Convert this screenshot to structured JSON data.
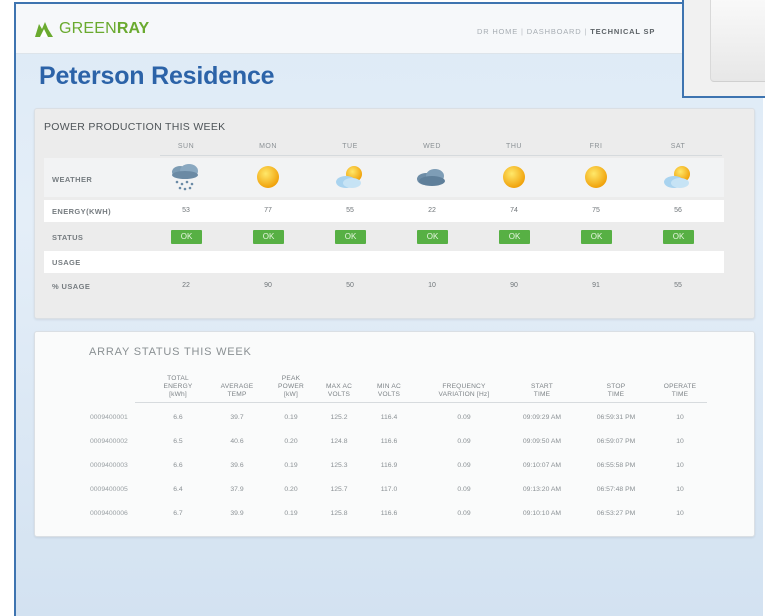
{
  "header": {
    "logo": {
      "part1": "GREEN",
      "part2": "RAY"
    },
    "nav": [
      "DR HOME",
      "DASHBOARD",
      "TECHNICAL SP"
    ],
    "nav_active_index": 2
  },
  "page_title": "Peterson Residence",
  "power": {
    "title": "POWER PRODUCTION THIS WEEK",
    "days": [
      "SUN",
      "MON",
      "TUE",
      "WED",
      "THU",
      "FRI",
      "SAT"
    ],
    "row_labels": {
      "weather": "WEATHER",
      "energy": "ENERGY(KWH)",
      "status": "STATUS",
      "usage": "USAGE",
      "pct_usage": "% USAGE"
    },
    "weather": [
      "rain-cloud-icon",
      "sun-icon",
      "partly-cloudy-icon",
      "cloud-icon",
      "sun-icon",
      "sun-icon",
      "partly-cloudy-icon"
    ],
    "energy": [
      "53",
      "77",
      "55",
      "22",
      "74",
      "75",
      "56"
    ],
    "status": [
      "OK",
      "OK",
      "OK",
      "OK",
      "OK",
      "OK",
      "OK"
    ],
    "pct_usage": [
      "22",
      "90",
      "50",
      "10",
      "90",
      "91",
      "55"
    ]
  },
  "array": {
    "title": "ARRAY STATUS THIS WEEK",
    "columns": [
      [
        "TOTAL",
        "ENERGY",
        "[kWh]"
      ],
      [
        "AVERAGE",
        "TEMP"
      ],
      [
        "PEAK",
        "POWER",
        "[kW]"
      ],
      [
        "MAX AC",
        "VOLTS"
      ],
      [
        "MIN AC",
        "VOLTS"
      ],
      [
        "FREQUENCY",
        "VARIATION [Hz]"
      ],
      [
        "START",
        "TIME"
      ],
      [
        "STOP",
        "TIME"
      ],
      [
        "OPERATE",
        "TIME"
      ]
    ],
    "rows": [
      [
        "0009400001",
        "6.6",
        "39.7",
        "0.19",
        "125.2",
        "116.4",
        "0.09",
        "09:09:29 AM",
        "06:59:31 PM",
        "10"
      ],
      [
        "0009400002",
        "6.5",
        "40.6",
        "0.20",
        "124.8",
        "116.6",
        "0.09",
        "09:09:50 AM",
        "06:59:07 PM",
        "10"
      ],
      [
        "0009400003",
        "6.6",
        "39.6",
        "0.19",
        "125.3",
        "116.9",
        "0.09",
        "09:10:07 AM",
        "06:55:58 PM",
        "10"
      ],
      [
        "0009400005",
        "6.4",
        "37.9",
        "0.20",
        "125.7",
        "117.0",
        "0.09",
        "09:13:20 AM",
        "06:57:48 PM",
        "10"
      ],
      [
        "0009400006",
        "6.7",
        "39.9",
        "0.19",
        "125.8",
        "116.6",
        "0.09",
        "09:10:10 AM",
        "06:53:27 PM",
        "10"
      ]
    ]
  },
  "colors": {
    "brand_green": "#6aaa2f",
    "title_blue": "#2c63a8",
    "ok_green": "#57b044",
    "frame_blue": "#3e74b0"
  }
}
